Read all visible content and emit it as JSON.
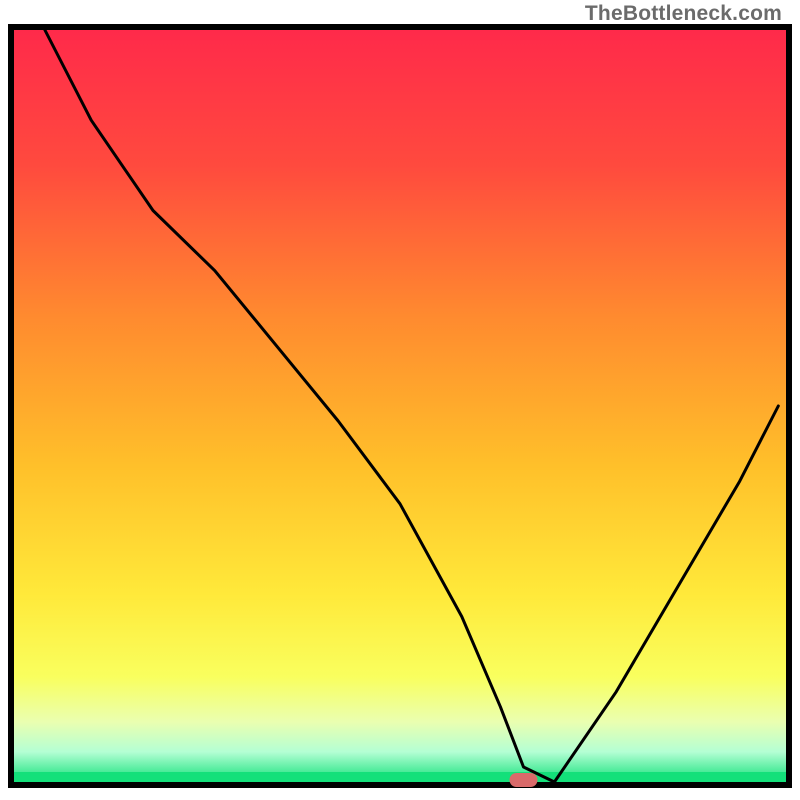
{
  "watermark": "TheBottleneck.com",
  "chart_data": {
    "type": "line",
    "title": "",
    "xlabel": "",
    "ylabel": "",
    "xlim": [
      0,
      100
    ],
    "ylim": [
      0,
      100
    ],
    "series": [
      {
        "name": "bottleneck-curve",
        "x": [
          4,
          10,
          18,
          26,
          34,
          42,
          50,
          58,
          63,
          66,
          70,
          78,
          86,
          94,
          99
        ],
        "values": [
          100,
          88,
          76,
          68,
          58,
          48,
          37,
          22,
          10,
          2,
          0,
          12,
          26,
          40,
          50
        ]
      }
    ],
    "marker": {
      "x": 66,
      "y": 0,
      "color": "#d96a6a"
    },
    "gradient_stops": [
      {
        "offset": 0.0,
        "color": "#ff2a4a"
      },
      {
        "offset": 0.18,
        "color": "#ff4a3e"
      },
      {
        "offset": 0.38,
        "color": "#ff8a2f"
      },
      {
        "offset": 0.58,
        "color": "#ffc02a"
      },
      {
        "offset": 0.75,
        "color": "#ffe93a"
      },
      {
        "offset": 0.86,
        "color": "#f9ff5e"
      },
      {
        "offset": 0.92,
        "color": "#eaffb0"
      },
      {
        "offset": 0.96,
        "color": "#b4ffd4"
      },
      {
        "offset": 1.0,
        "color": "#13e07a"
      }
    ],
    "frame_color": "#000000",
    "line_color": "#000000",
    "line_width": 3
  }
}
